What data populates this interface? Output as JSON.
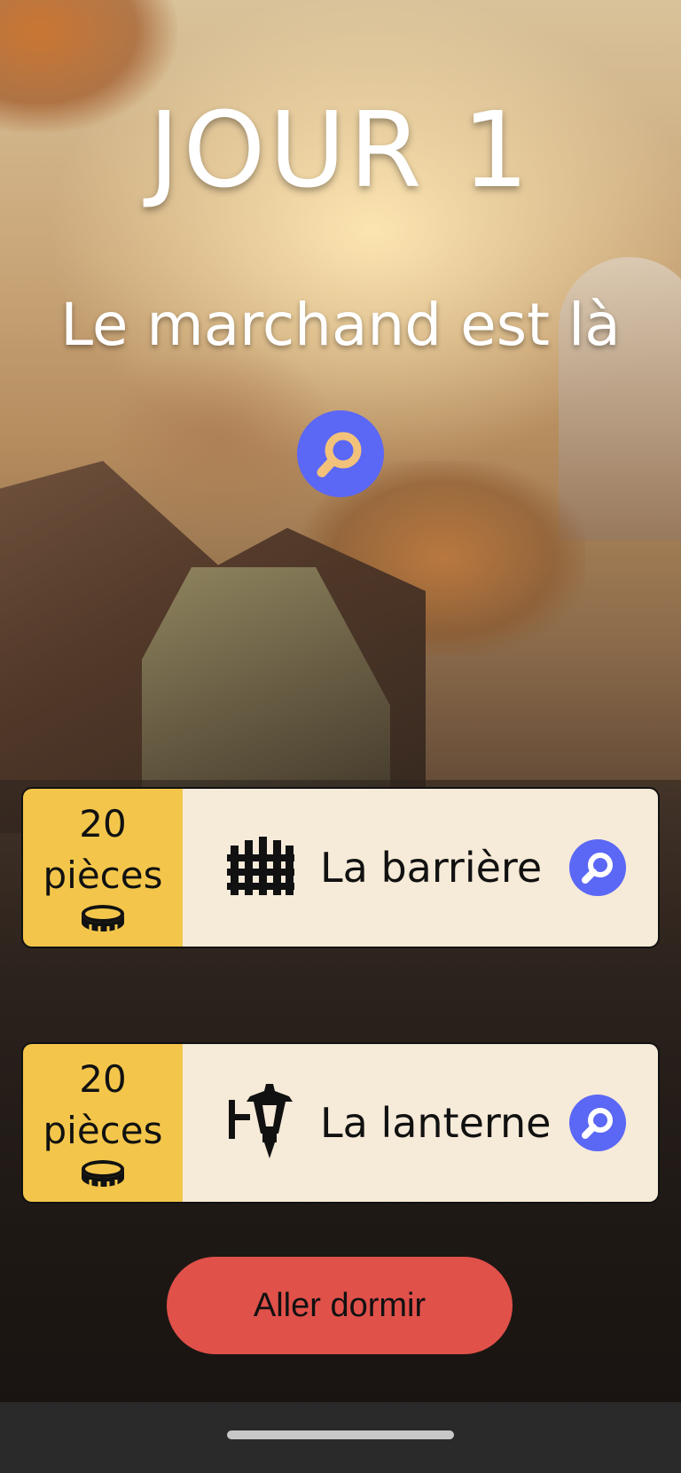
{
  "header": {
    "day_title": "JOUR 1",
    "subtitle": "Le marchand est là"
  },
  "shop_items": [
    {
      "price_amount": "20",
      "price_unit": "pièces",
      "name": "La barrière",
      "icon": "fence-icon"
    },
    {
      "price_amount": "20",
      "price_unit": "pièces",
      "name": "La lanterne",
      "icon": "lantern-icon"
    }
  ],
  "actions": {
    "sleep_label": "Aller dormir"
  },
  "colors": {
    "accent_blue": "#5b67f5",
    "price_yellow": "#f3c64b",
    "card_cream": "#f6ead8",
    "sleep_red": "#e0514a"
  }
}
